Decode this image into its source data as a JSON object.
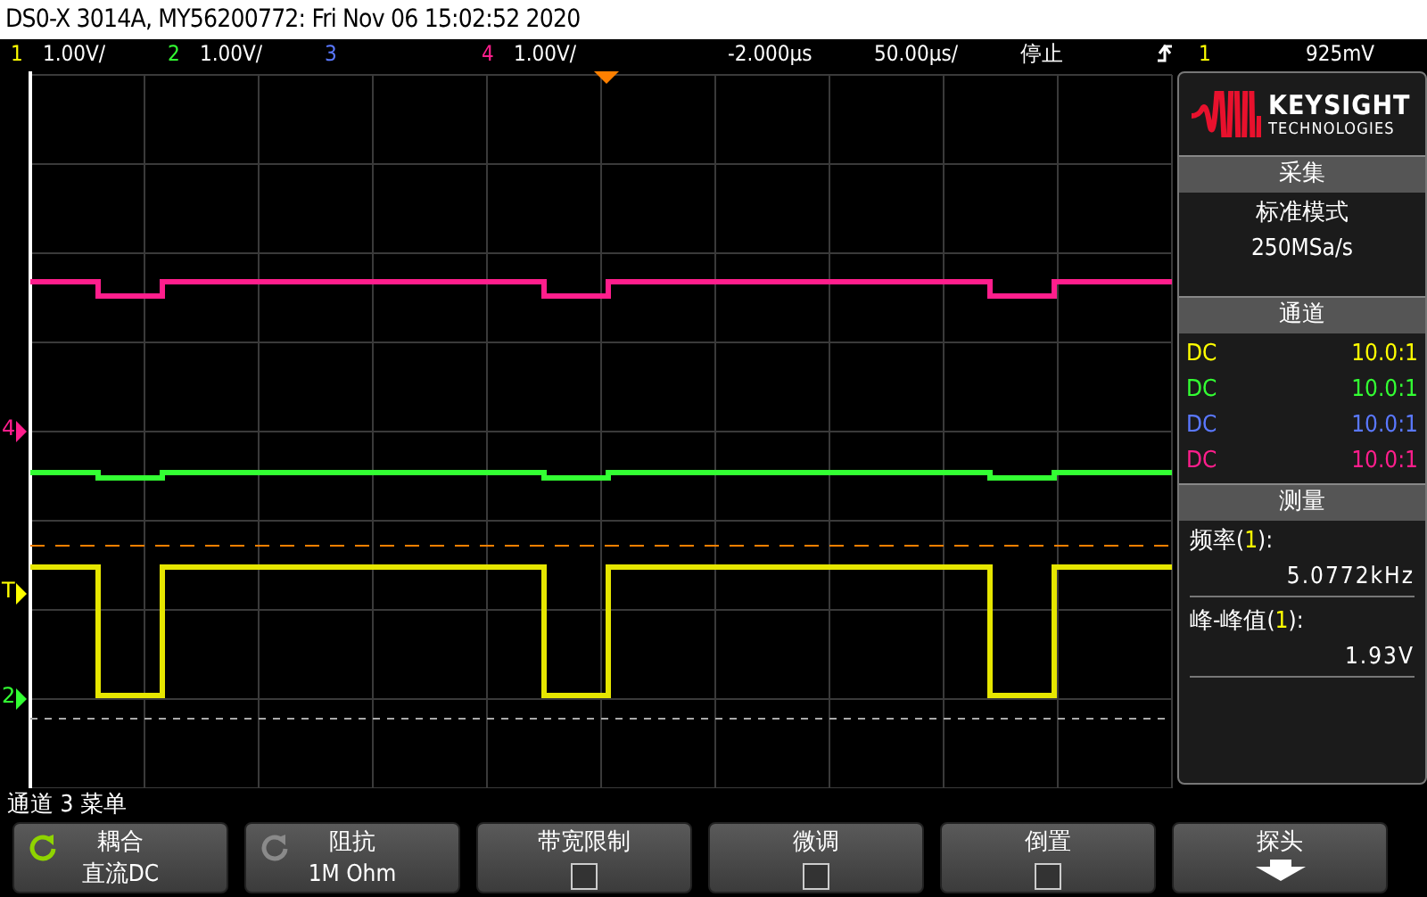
{
  "window": {
    "title": "DS0-X 3014A, MY56200772: Fri Nov 06 15:02:52 2020"
  },
  "status_bar": {
    "channels": [
      {
        "number": "1",
        "scale": "1.00V/",
        "color": "#ffff00"
      },
      {
        "number": "2",
        "scale": "1.00V/",
        "color": "#33ff33"
      },
      {
        "number": "3",
        "color": "#5a78ff"
      },
      {
        "number": "4",
        "scale": "1.00V/",
        "color": "#ff1e8c"
      }
    ],
    "delay": "-2.000µs",
    "timebase": "50.00µs/",
    "run_state": "停止",
    "trigger": {
      "channel": "1",
      "color": "#ffff00",
      "level": "925mV"
    }
  },
  "screen": {
    "markers": [
      {
        "label": "4",
        "color": "#ff1e8c"
      },
      {
        "label": "T",
        "color": "#ffff00"
      },
      {
        "label": "2",
        "color": "#33ff33"
      }
    ]
  },
  "side_panel": {
    "logo": {
      "name": "KEYSIGHT",
      "subtitle": "TECHNOLOGIES"
    },
    "acquisition": {
      "title": "采集",
      "mode": "标准模式",
      "rate": "250MSa/s"
    },
    "channels": {
      "title": "通道",
      "rows": [
        {
          "coupling": "DC",
          "ratio": "10.0:1",
          "color": "#ffff00"
        },
        {
          "coupling": "DC",
          "ratio": "10.0:1",
          "color": "#33ff33"
        },
        {
          "coupling": "DC",
          "ratio": "10.0:1",
          "color": "#5a78ff"
        },
        {
          "coupling": "DC",
          "ratio": "10.0:1",
          "color": "#ff1e8c"
        }
      ]
    },
    "measurements": {
      "title": "测量",
      "items": [
        {
          "name": "频率(",
          "source": "1",
          "suffix": "):",
          "color": "#ffff00",
          "value": "5.0772kHz"
        },
        {
          "name": "峰-峰值(",
          "source": "1",
          "suffix": "):",
          "color": "#ffff00",
          "value": "1.93V"
        }
      ]
    }
  },
  "menu": {
    "title": "通道 3 菜单",
    "softkeys": [
      {
        "kind": "cycle",
        "label": "耦合",
        "value": "直流DC",
        "disabled": false
      },
      {
        "kind": "cycle",
        "label": "阻抗",
        "value": "1M Ohm",
        "disabled": true
      },
      {
        "kind": "checkbox",
        "label": "带宽限制",
        "checked": false
      },
      {
        "kind": "checkbox",
        "label": "微调",
        "checked": false
      },
      {
        "kind": "checkbox",
        "label": "倒置",
        "checked": false
      },
      {
        "kind": "submenu",
        "label": "探头"
      }
    ]
  }
}
